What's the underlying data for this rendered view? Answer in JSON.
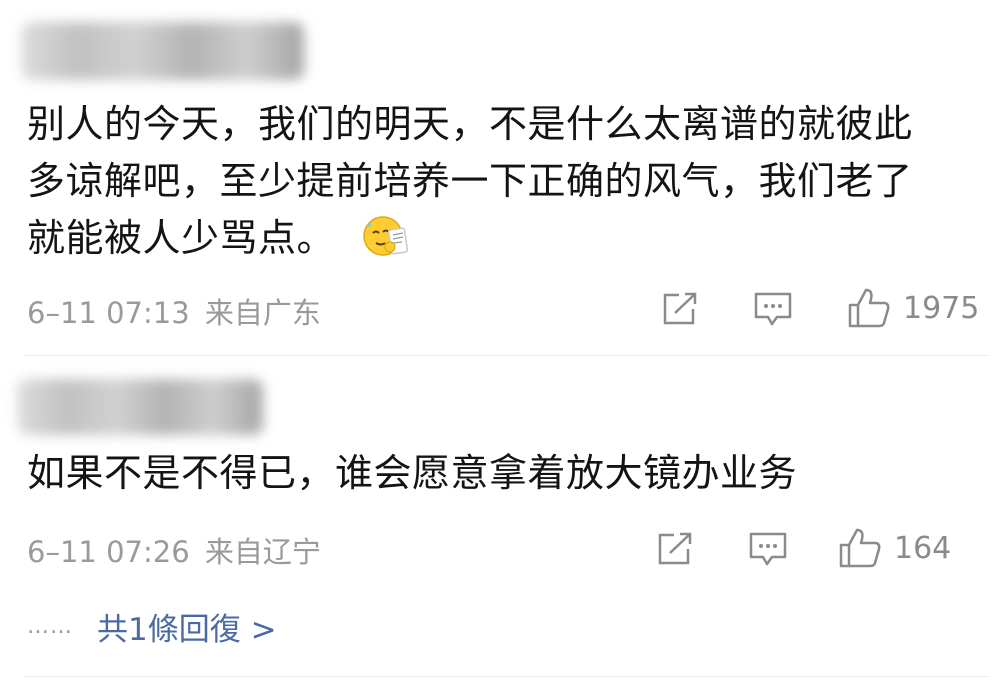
{
  "comments": [
    {
      "text_lines": [
        "别人的今天，我们的明天，不是什么太离谱的就彼此",
        "多谅解吧，至少提前培养一下正确的风气，我们老了",
        "就能被人少骂点。"
      ],
      "time": "6–11 07:13",
      "location": "来自广东",
      "likes": "1975",
      "emoji": "sweat-card-emoji"
    },
    {
      "text_lines": [
        "如果不是不得已，谁会愿意拿着放大镜办业务"
      ],
      "time": "6–11 07:26",
      "location": "来自辽宁",
      "likes": "164",
      "replies": {
        "dots": "……",
        "label": "共1條回復 >"
      }
    }
  ],
  "colors": {
    "text": "#141414",
    "meta": "#9a9a9a",
    "icon": "#8a8a8a",
    "link": "#4a6aa5",
    "divider": "#ececec"
  }
}
